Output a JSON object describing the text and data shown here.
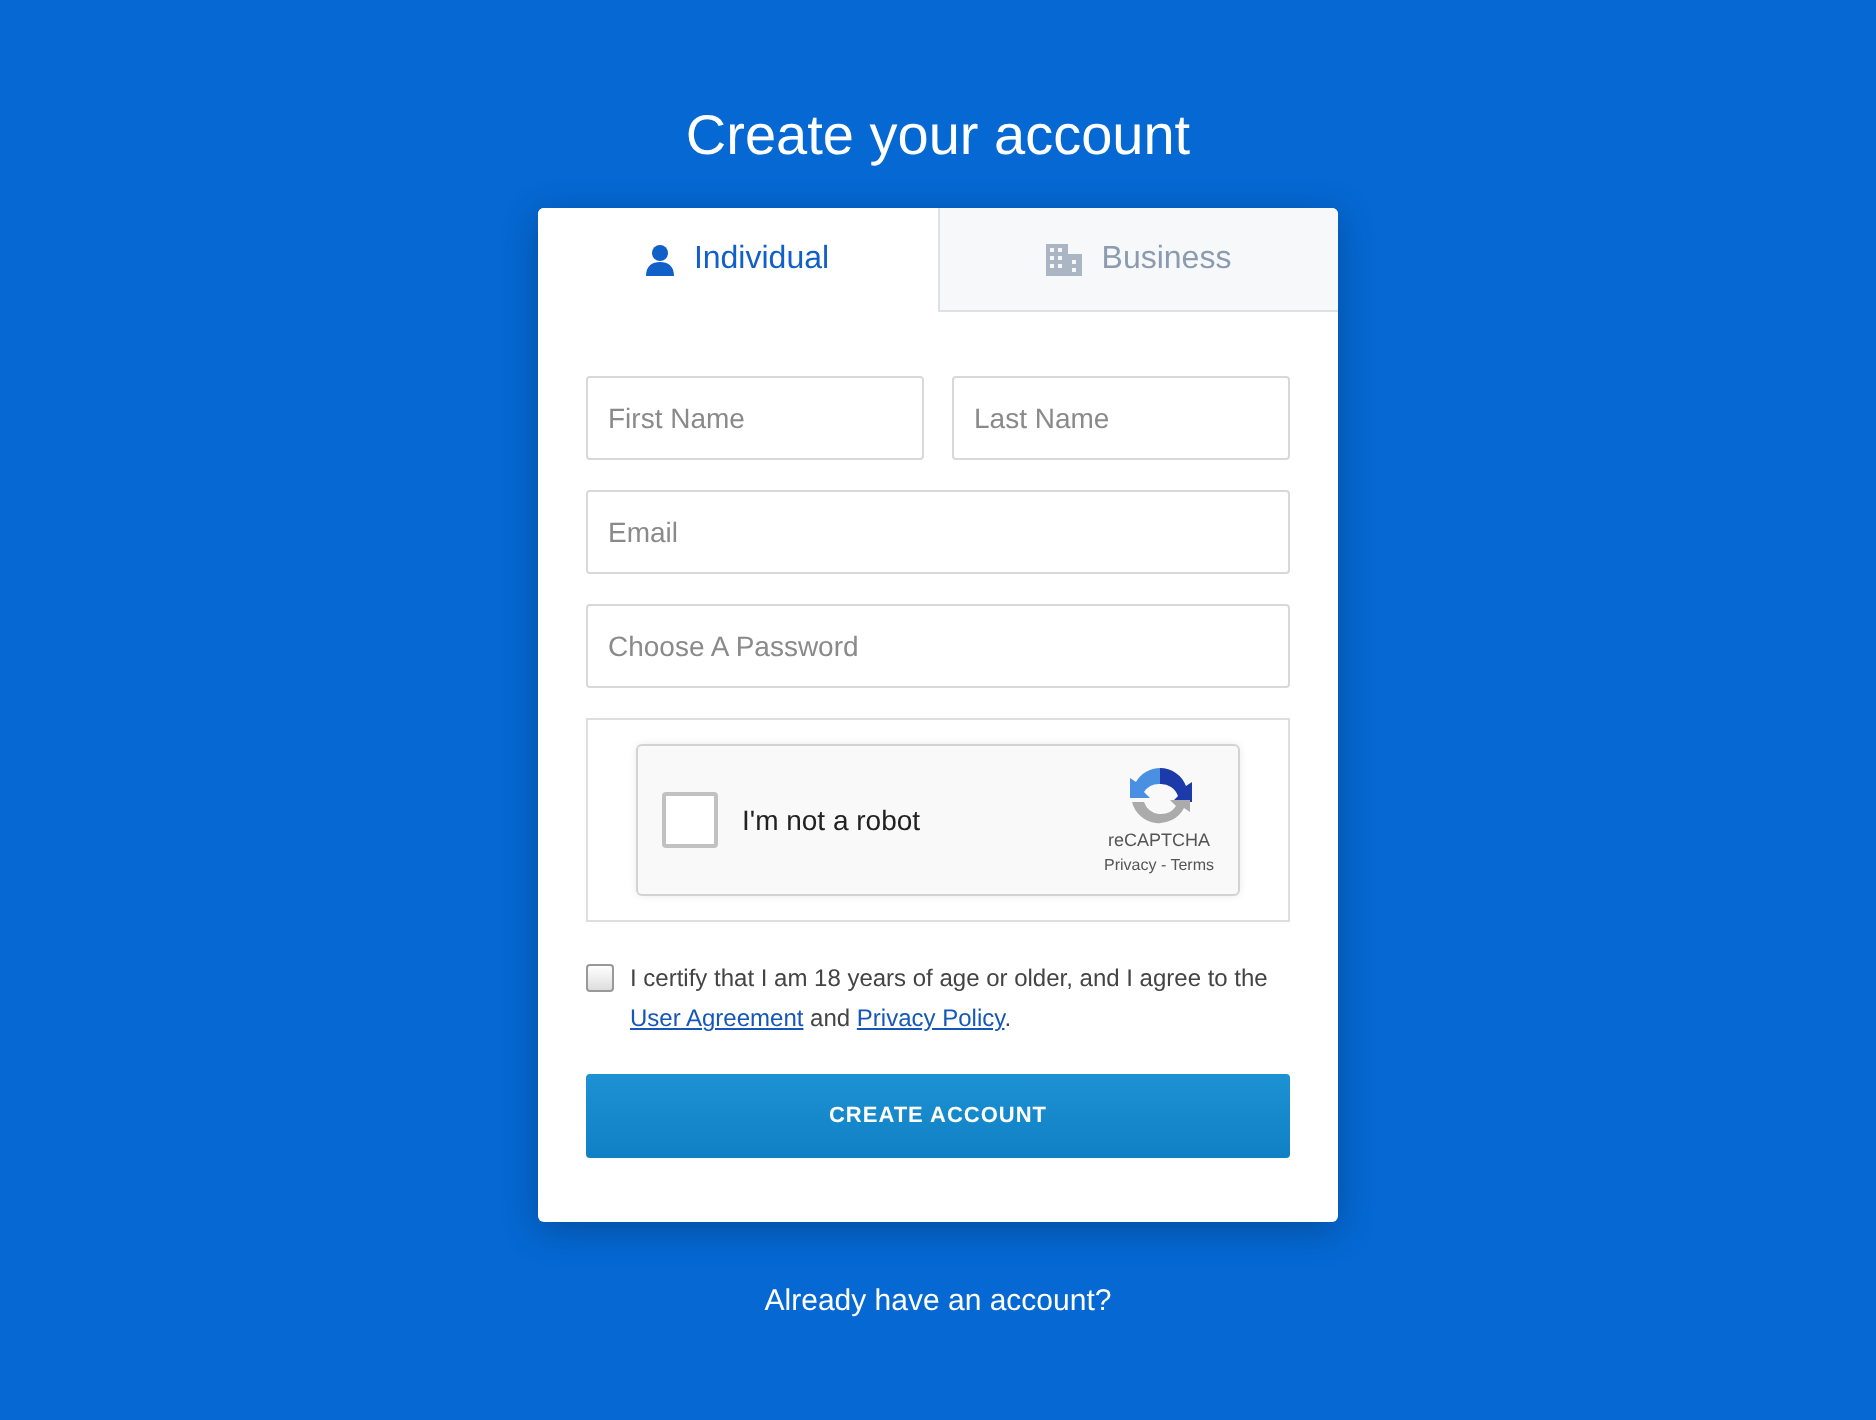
{
  "title": "Create your account",
  "tabs": [
    {
      "label": "Individual",
      "kind": "person",
      "selected": true
    },
    {
      "label": "Business",
      "kind": "building",
      "selected": false
    }
  ],
  "fields": [
    {
      "placeholder": "First Name",
      "kind": "half"
    },
    {
      "placeholder": "Last Name",
      "kind": "half"
    },
    {
      "placeholder": "Email",
      "kind": "full"
    },
    {
      "placeholder": "Choose A Password",
      "kind": "password"
    }
  ],
  "captcha": {
    "checked": false,
    "label": "I'm not a robot",
    "brand": "reCAPTCHA",
    "links": "Privacy - Terms"
  },
  "consent": {
    "checked": false,
    "parts": [
      {
        "kind": "text",
        "text": "I certify that I am 18 years of age or older, and I agree to the "
      },
      {
        "kind": "link",
        "text": "User Agreement"
      },
      {
        "kind": "text",
        "text": " and "
      },
      {
        "kind": "link",
        "text": "Privacy Policy"
      },
      {
        "kind": "text",
        "text": "."
      }
    ]
  },
  "submit": "CREATE ACCOUNT",
  "footer_link": "Already have an account?"
}
